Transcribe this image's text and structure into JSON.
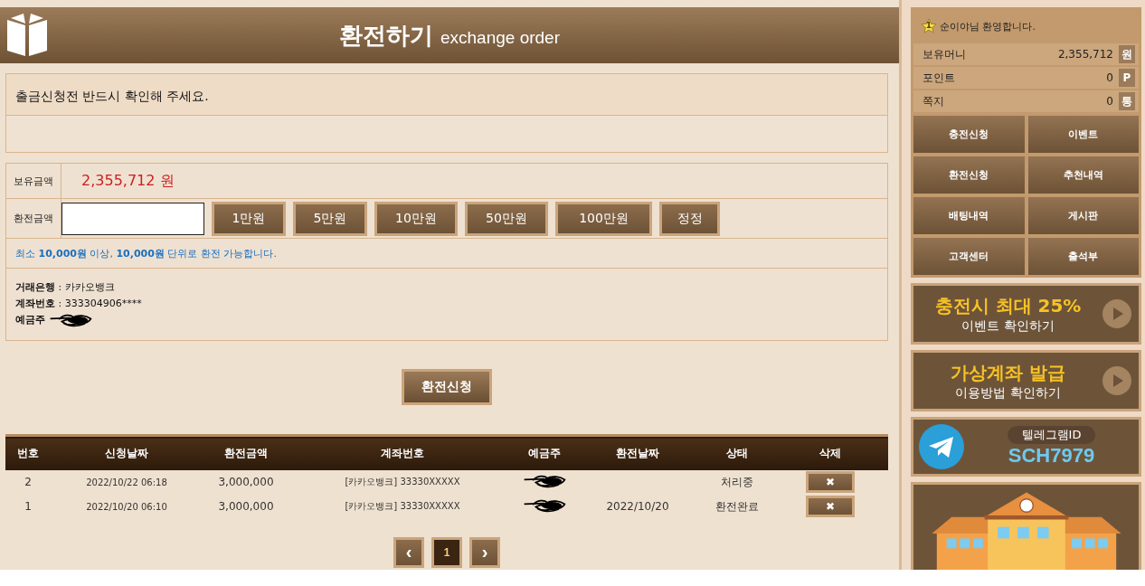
{
  "header": {
    "title": "환전하기",
    "subtitle": "exchange order"
  },
  "notice": {
    "text": "출금신청전 반드시 확인해 주세요."
  },
  "form": {
    "balance_label": "보유금액",
    "balance": "2,355,712 원",
    "amount_label": "환전금액",
    "quick_buttons": [
      "1만원",
      "5만원",
      "10만원",
      "50만원",
      "100만원",
      "정정"
    ],
    "info": "최소 **10,000원** 이상, **10,000원**  단위로 환전 가능합니다.",
    "bank_lines": [
      "**거래은행** : 카카오뱅크",
      "**계좌번호** : 333304906****"
    ],
    "holder_label": "예금주",
    "holder_redacted": true
  },
  "submit_button": "환전신청",
  "table": {
    "columns": [
      "번호",
      "신청날짜",
      "환전금액",
      "계좌번호",
      "예금주",
      "환전날짜",
      "상태",
      "삭제"
    ],
    "rows": [
      {
        "no": "2",
        "requested": "2022/10/22 06:18",
        "amount": "3,000,000",
        "account": "[카카오뱅크] 33330XXXXX",
        "holder_redacted": true,
        "exchanged": "",
        "status": "처리중",
        "delete": "✖"
      },
      {
        "no": "1",
        "requested": "2022/10/20 06:10",
        "amount": "3,000,000",
        "account": "[카카오뱅크] 33330XXXXX",
        "holder_redacted": true,
        "exchanged": "2022/10/20",
        "status": "환전완료",
        "delete": "✖"
      }
    ]
  },
  "pagination": {
    "prev": "‹",
    "pages": [
      {
        "label": "1",
        "selected": true
      }
    ],
    "next": "›"
  },
  "sidebar": {
    "welcome": {
      "level": "1",
      "text": "순이야님 환영합니다."
    },
    "stats": [
      {
        "label": "보유머니",
        "value": "2,355,712",
        "unit": "원"
      },
      {
        "label": "포인트",
        "value": "0",
        "unit": "P"
      },
      {
        "label": "쪽지",
        "value": "0",
        "unit": "통"
      }
    ],
    "menu": [
      "충전신청",
      "이벤트",
      "환전신청",
      "추천내역",
      "배팅내역",
      "게시판",
      "고객센터",
      "출석부"
    ],
    "banners": [
      {
        "title": "충전시 최대 25%",
        "subtitle": "이벤트 확인하기"
      },
      {
        "title": "가상계좌 발급",
        "subtitle": "이용방법 확인하기"
      }
    ],
    "telegram": {
      "label": "텔레그램ID",
      "id": "SCH7979"
    }
  }
}
